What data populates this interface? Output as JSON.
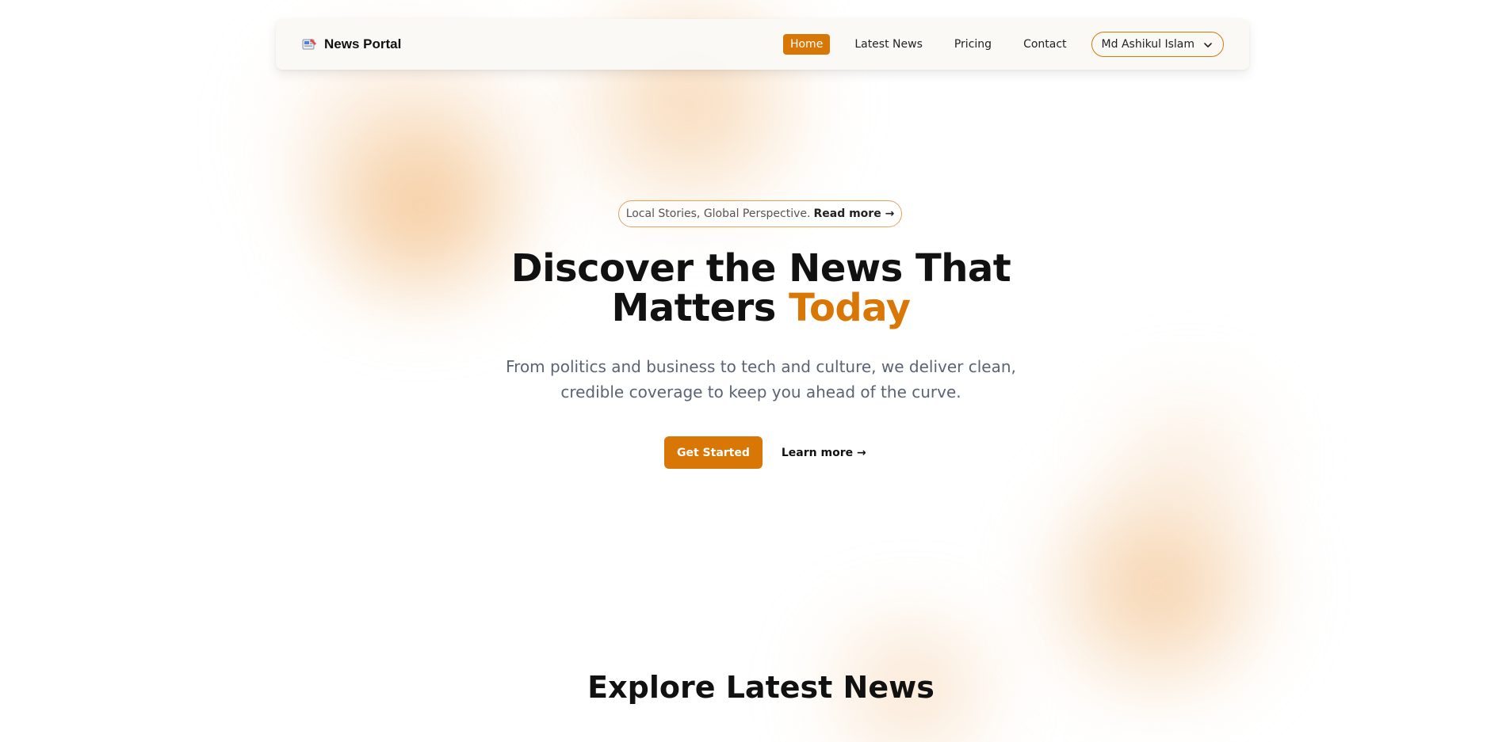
{
  "colors": {
    "accent": "#d97706",
    "accent_border": "#e6a15a",
    "text_dark": "#111111",
    "text_muted": "#5b6472",
    "navbar_bg": "#faf9f6"
  },
  "navbar": {
    "brand": {
      "icon": "newspaper-icon",
      "name": "News Portal"
    },
    "links": [
      {
        "label": "Home",
        "active": true
      },
      {
        "label": "Latest News",
        "active": false
      },
      {
        "label": "Pricing",
        "active": false
      },
      {
        "label": "Contact",
        "active": false
      }
    ],
    "user_menu": {
      "name": "Md Ashikul Islam",
      "icon": "chevron-down-icon"
    }
  },
  "hero": {
    "tagline": {
      "text": "Local Stories, Global Perspective.",
      "link": "Read more →"
    },
    "headline": {
      "prefix": "Discover the News That Matters ",
      "highlight": "Today"
    },
    "subtitle": "From politics and business to tech and culture, we deliver clean, credible coverage to keep you ahead of the curve.",
    "primary_button": "Get Started",
    "secondary_link": "Learn more →"
  },
  "latest_section": {
    "title": "Explore Latest News"
  }
}
